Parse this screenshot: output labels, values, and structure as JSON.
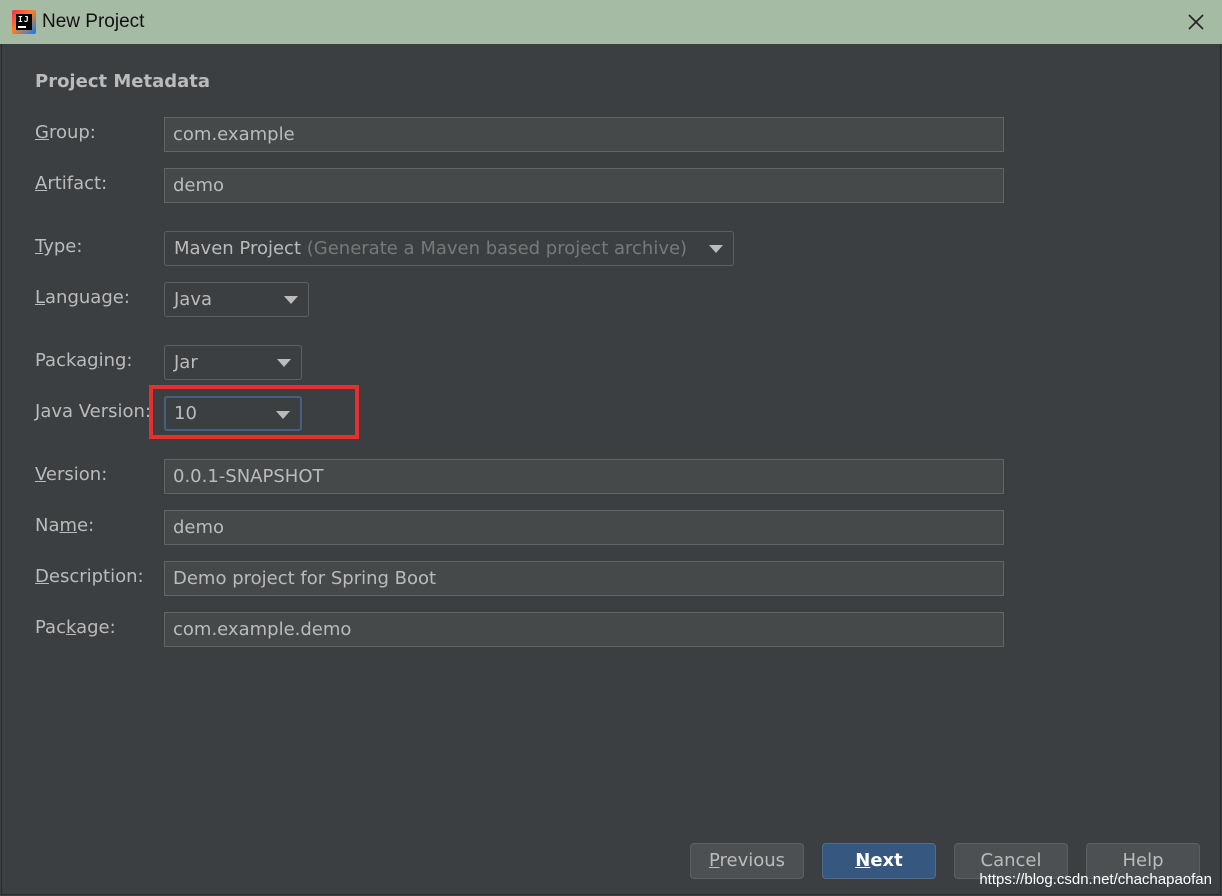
{
  "window": {
    "title": "New Project",
    "close_icon": "close-icon",
    "app_icon": "intellij-logo-icon"
  },
  "form": {
    "section_title": "Project Metadata",
    "group": {
      "label_mnemonic": "G",
      "label_rest": "roup:",
      "value": "com.example"
    },
    "artifact": {
      "label_mnemonic": "A",
      "label_rest": "rtifact:",
      "value": "demo"
    },
    "type": {
      "label_mnemonic": "T",
      "label_rest": "ype:",
      "value": "Maven Project",
      "hint": "(Generate a Maven based project archive)"
    },
    "language": {
      "label_mnemonic": "L",
      "label_rest": "anguage:",
      "value": "Java"
    },
    "packaging": {
      "label_pre": "Packa",
      "label_mnemonic": "g",
      "label_rest": "ing:",
      "value": "Jar"
    },
    "java_version": {
      "label_mnemonic": "J",
      "label_rest": "ava Version:",
      "value": "10"
    },
    "version": {
      "label_mnemonic": "V",
      "label_rest": "ersion:",
      "value": "0.0.1-SNAPSHOT"
    },
    "name": {
      "label_pre": "Na",
      "label_mnemonic": "m",
      "label_rest": "e:",
      "value": "demo"
    },
    "description": {
      "label_mnemonic": "D",
      "label_rest": "escription:",
      "value": "Demo project for Spring Boot"
    },
    "package": {
      "label_pre": "Pac",
      "label_mnemonic": "k",
      "label_rest": "age:",
      "value": "com.example.demo"
    }
  },
  "buttons": {
    "previous": {
      "mnemonic": "P",
      "rest": "revious"
    },
    "next": {
      "mnemonic": "N",
      "rest": "ext"
    },
    "cancel": "Cancel",
    "help": "Help"
  },
  "watermark": "https://blog.csdn.net/chachapaofan",
  "colors": {
    "background": "#3c3f41",
    "titlebar": "#a5bba4",
    "primary_button": "#365880",
    "highlight": "#e63030",
    "focus_border": "#46607e"
  }
}
